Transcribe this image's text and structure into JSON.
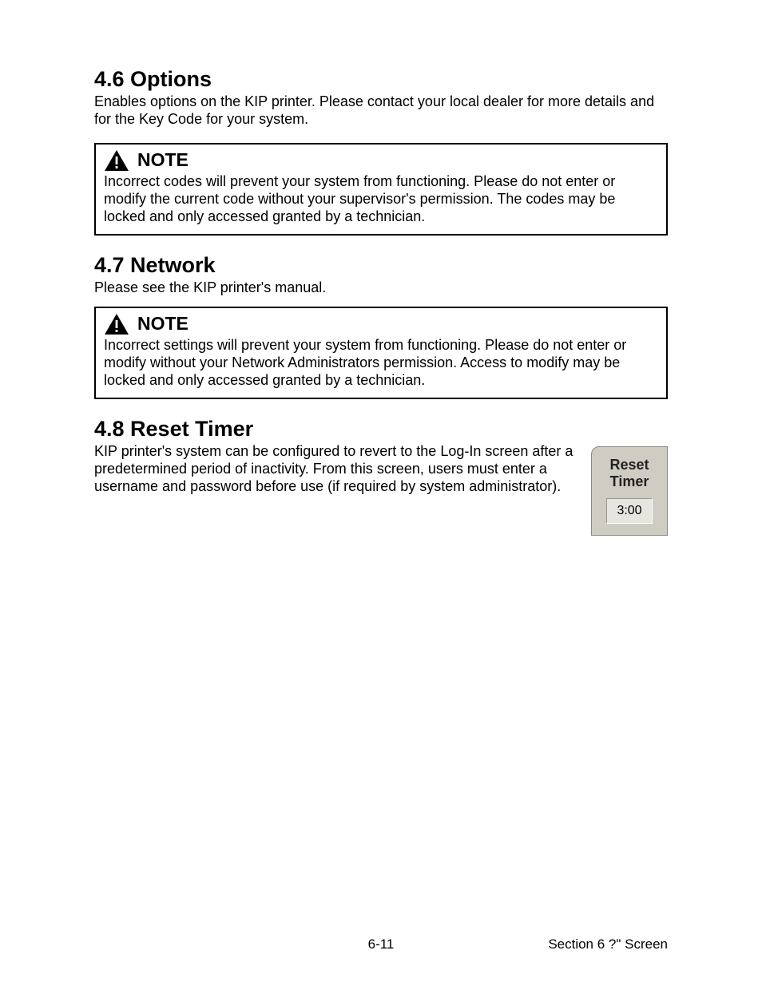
{
  "sections": {
    "options": {
      "heading": "4.6   Options",
      "body": "Enables options on the KIP printer. Please contact your local dealer for more details and for the Key Code for your system."
    },
    "network": {
      "heading": "4.7   Network",
      "body": "Please see the KIP printer's manual."
    },
    "reset": {
      "heading": "4.8  Reset Timer",
      "body": "KIP printer's system can be configured to revert to the Log-In screen after a predetermined period of inactivity.  From this screen, users must enter a username and password before use (if required by system administrator)."
    }
  },
  "notes": {
    "note1": {
      "title": "NOTE",
      "body": "Incorrect codes will prevent your system from functioning. Please do not enter or modify the current code without your supervisor's permission. The codes may be locked and only accessed granted by a technician."
    },
    "note2": {
      "title": "NOTE",
      "body": "Incorrect settings will prevent your system from functioning. Please do not enter or modify without your Network Administrators permission. Access to modify may be locked and only accessed granted by a technician."
    }
  },
  "reset_widget": {
    "title": "Reset Timer",
    "value": "3:00"
  },
  "footer": {
    "page": "6-11",
    "section": "Section 6    ?\" Screen"
  }
}
